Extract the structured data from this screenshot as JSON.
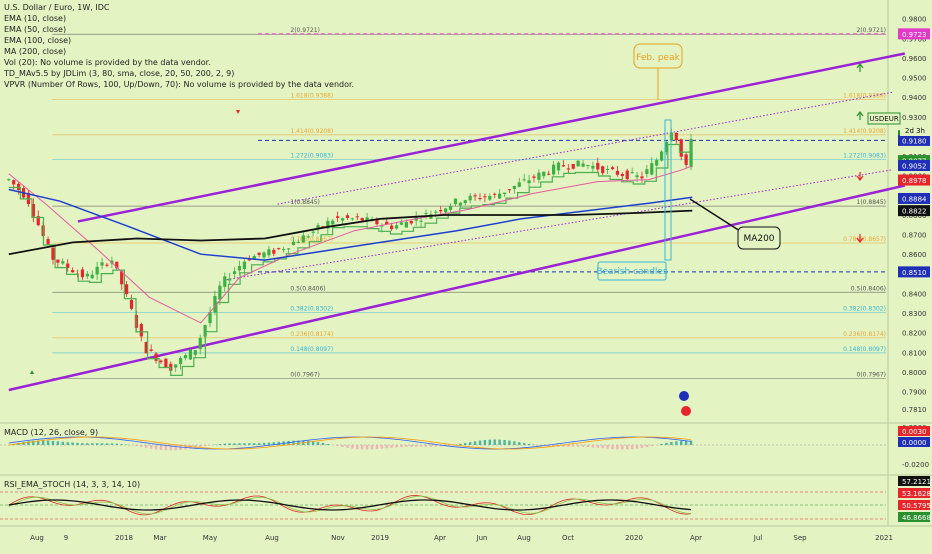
{
  "legend": {
    "symbol": "U.S. Dollar / Euro, 1W, IDC",
    "lines": [
      "EMA (10, close)",
      "EMA (50, close)",
      "EMA (100, close)",
      "MA (200, close)",
      "Vol (20): No volume is provided by the data vendor.",
      "TD_MAv5.5 by JDLim (3, 80, sma, close, 20, 50, 200, 2, 9)",
      "VPVR (Number Of Rows, 100, Up/Down, 70): No volume is provided by the data vendor."
    ]
  },
  "macd": {
    "label": "MACD (12, 26, close, 9)",
    "ticks": [
      "0.0200",
      "-0.0200"
    ],
    "badges": [
      "0.0030",
      "0.0000"
    ]
  },
  "rsi": {
    "label": "RSI_EMA_STOCH (14, 3, 3, 14, 10)",
    "ticks": [
      "57.2121",
      "53.1628",
      "50.5795",
      "46.8668"
    ]
  },
  "annotations": {
    "feb_peak": "Feb. peak",
    "bearish": "Bearish candles",
    "ma200": "MA200",
    "symbol_tag": "USDEUR",
    "countdown": "2d 3h"
  },
  "colors": {
    "up": "#3cb043",
    "down": "#e8252a",
    "channel": "#9b22d6",
    "background": "#e3f3c2"
  },
  "chart_data": {
    "type": "candlestick",
    "price_axis": {
      "ylim": [
        0.775,
        0.987
      ],
      "ticks": [
        "0.9800",
        "0.9700",
        "0.9600",
        "0.9500",
        "0.9400",
        "0.9300",
        "0.9200",
        "0.9100",
        "0.9000",
        "0.8900",
        "0.8800",
        "0.8700",
        "0.8600",
        "0.8500",
        "0.8400",
        "0.8300",
        "0.8200",
        "0.8100",
        "0.8000",
        "0.7900",
        "0.7810"
      ]
    },
    "price_badges": [
      {
        "value": 0.9723,
        "text": "0.9723",
        "color": "#e339c8"
      },
      {
        "value": 0.9204,
        "text": "0.9204",
        "color": "#2b8f2e"
      },
      {
        "value": 0.918,
        "text": "0.9180",
        "color": "#1f2fb8"
      },
      {
        "value": 0.9077,
        "text": "0.9077",
        "color": "#2b8f2e"
      },
      {
        "value": 0.9052,
        "text": "0.9052",
        "color": "#1f2fb8"
      },
      {
        "value": 0.8978,
        "text": "0.8978",
        "color": "#e8252a"
      },
      {
        "value": 0.8884,
        "text": "0.8884",
        "color": "#1f2fb8"
      },
      {
        "value": 0.8822,
        "text": "0.8822",
        "color": "#111111"
      },
      {
        "value": 0.851,
        "text": "0.8510",
        "color": "#1f2fb8"
      }
    ],
    "time_axis": {
      "labels": [
        "Aug",
        "9",
        "2018",
        "Mar",
        "May",
        "Aug",
        "Nov",
        "2019",
        "Apr",
        "Jun",
        "Aug",
        "Oct",
        "2020",
        "Apr",
        "Jul",
        "Sep",
        "2021"
      ]
    },
    "horizontal_levels": [
      {
        "value": 0.9723,
        "style": "dashed",
        "color": "#e339c8"
      },
      {
        "value": 0.918,
        "style": "dashed",
        "color": "#1f2fb8"
      },
      {
        "value": 0.851,
        "style": "dashed",
        "color": "#1f2fb8"
      }
    ],
    "fibonacci": [
      {
        "ratio": "0",
        "value": 0.7967,
        "label": "0(0.7967)",
        "color": "#555555"
      },
      {
        "ratio": "0.148",
        "value": 0.8097,
        "label": "0.148(0.8097)",
        "color": "#35b6d8"
      },
      {
        "ratio": "0.236",
        "value": 0.8174,
        "label": "0.236(0.8174)",
        "color": "#e8a838"
      },
      {
        "ratio": "0.382",
        "value": 0.8302,
        "label": "0.382(0.8302)",
        "color": "#35b6d8"
      },
      {
        "ratio": "0.5",
        "value": 0.8406,
        "label": "0.5(0.8406)",
        "color": "#555555"
      },
      {
        "ratio": "0.786",
        "value": 0.8657,
        "label": "0.786(0.8657)",
        "color": "#e8a838"
      },
      {
        "ratio": "1",
        "value": 0.8845,
        "label": "1(0.8845)",
        "color": "#555555"
      },
      {
        "ratio": "1.272",
        "value": 0.9083,
        "label": "1.272(0.9083)",
        "color": "#35b6d8"
      },
      {
        "ratio": "1.414",
        "value": 0.9208,
        "label": "1.414(0.9208)",
        "color": "#e8a838"
      },
      {
        "ratio": "1.618",
        "value": 0.9388,
        "label": "1.618(0.9388)",
        "color": "#e8a838"
      },
      {
        "ratio": "2",
        "value": 0.9721,
        "label": "2(0.9721)",
        "color": "#555555"
      }
    ],
    "channel": {
      "upper": [
        [
          2017.82,
          0.8767
        ],
        [
          2021.05,
          0.9623
        ]
      ],
      "lower": [
        [
          2017.55,
          0.7908
        ],
        [
          2021.05,
          0.895
        ]
      ]
    },
    "series_path": [
      [
        2017.55,
        0.898
      ],
      [
        2017.62,
        0.889
      ],
      [
        2017.72,
        0.858
      ],
      [
        2017.85,
        0.848
      ],
      [
        2017.95,
        0.858
      ],
      [
        2018.0,
        0.842
      ],
      [
        2018.08,
        0.812
      ],
      [
        2018.18,
        0.802
      ],
      [
        2018.28,
        0.812
      ],
      [
        2018.38,
        0.845
      ],
      [
        2018.48,
        0.858
      ],
      [
        2018.6,
        0.862
      ],
      [
        2018.72,
        0.87
      ],
      [
        2018.82,
        0.878
      ],
      [
        2018.92,
        0.878
      ],
      [
        2019.05,
        0.874
      ],
      [
        2019.18,
        0.88
      ],
      [
        2019.32,
        0.888
      ],
      [
        2019.45,
        0.89
      ],
      [
        2019.58,
        0.898
      ],
      [
        2019.7,
        0.905
      ],
      [
        2019.8,
        0.906
      ],
      [
        2019.9,
        0.902
      ],
      [
        2020.02,
        0.899
      ],
      [
        2020.08,
        0.908
      ],
      [
        2020.14,
        0.924
      ],
      [
        2020.17,
        0.916
      ],
      [
        2020.19,
        0.897
      ],
      [
        2020.21,
        0.92
      ]
    ],
    "ema_pink": [
      [
        2017.55,
        0.901
      ],
      [
        2017.7,
        0.885
      ],
      [
        2017.9,
        0.862
      ],
      [
        2018.1,
        0.838
      ],
      [
        2018.3,
        0.825
      ],
      [
        2018.45,
        0.848
      ],
      [
        2018.65,
        0.86
      ],
      [
        2018.9,
        0.872
      ],
      [
        2019.1,
        0.877
      ],
      [
        2019.35,
        0.883
      ],
      [
        2019.6,
        0.891
      ],
      [
        2019.85,
        0.897
      ],
      [
        2020.05,
        0.898
      ],
      [
        2020.18,
        0.903
      ],
      [
        2020.22,
        0.905
      ]
    ],
    "ema_blue": [
      [
        2017.55,
        0.893
      ],
      [
        2017.75,
        0.887
      ],
      [
        2018.0,
        0.875
      ],
      [
        2018.3,
        0.86
      ],
      [
        2018.55,
        0.857
      ],
      [
        2018.8,
        0.862
      ],
      [
        2019.05,
        0.867
      ],
      [
        2019.3,
        0.872
      ],
      [
        2019.55,
        0.878
      ],
      [
        2019.8,
        0.882
      ],
      [
        2020.05,
        0.886
      ],
      [
        2020.22,
        0.889
      ]
    ],
    "ma200": [
      [
        2017.55,
        0.86
      ],
      [
        2017.8,
        0.866
      ],
      [
        2018.05,
        0.868
      ],
      [
        2018.3,
        0.867
      ],
      [
        2018.55,
        0.868
      ],
      [
        2018.8,
        0.874
      ],
      [
        2019.0,
        0.878
      ],
      [
        2019.25,
        0.88
      ],
      [
        2019.5,
        0.88
      ],
      [
        2019.75,
        0.88
      ],
      [
        2020.0,
        0.881
      ],
      [
        2020.22,
        0.8822
      ]
    ],
    "macd_hist_range": [
      -0.02,
      0.02
    ],
    "rsi_range": [
      40,
      65
    ]
  }
}
